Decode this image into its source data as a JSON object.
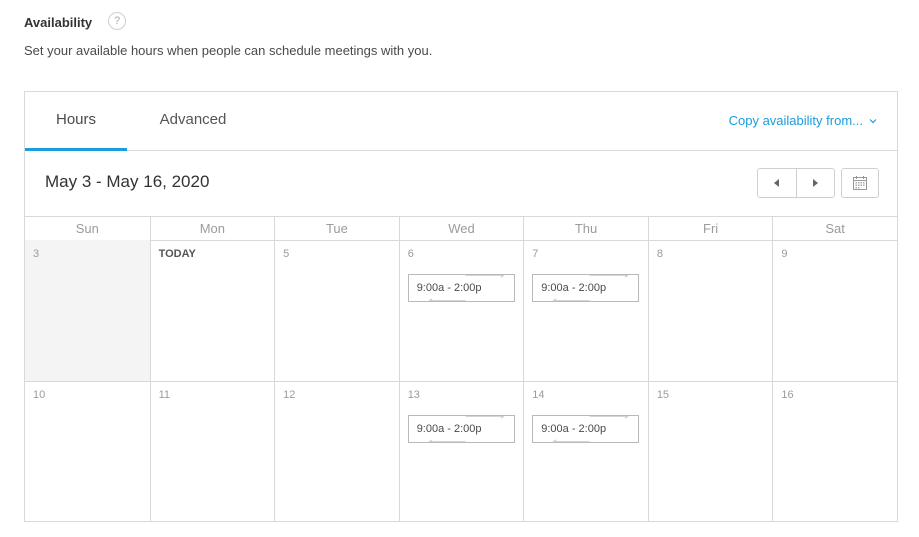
{
  "header": {
    "title": "Availability",
    "help_glyph": "?"
  },
  "subtitle": "Set your available hours when people can schedule meetings with you.",
  "tabs": [
    {
      "label": "Hours",
      "active": true
    },
    {
      "label": "Advanced",
      "active": false
    }
  ],
  "copy_link": "Copy availability from...",
  "range_title": "May 3 - May 16, 2020",
  "weekdays": [
    "Sun",
    "Mon",
    "Tue",
    "Wed",
    "Thu",
    "Fri",
    "Sat"
  ],
  "weeks": [
    [
      {
        "label": "3",
        "past": true,
        "slot": ""
      },
      {
        "label": "TODAY",
        "today": true,
        "slot": ""
      },
      {
        "label": "5",
        "slot": ""
      },
      {
        "label": "6",
        "slot": "9:00a - 2:00p"
      },
      {
        "label": "7",
        "slot": "9:00a - 2:00p"
      },
      {
        "label": "8",
        "slot": ""
      },
      {
        "label": "9",
        "slot": ""
      }
    ],
    [
      {
        "label": "10",
        "slot": ""
      },
      {
        "label": "11",
        "slot": ""
      },
      {
        "label": "12",
        "slot": ""
      },
      {
        "label": "13",
        "slot": "9:00a - 2:00p"
      },
      {
        "label": "14",
        "slot": "9:00a - 2:00p"
      },
      {
        "label": "15",
        "slot": ""
      },
      {
        "label": "16",
        "slot": ""
      }
    ]
  ],
  "colors": {
    "accent": "#1a9ddc",
    "border": "#d9d9d9",
    "past_bg": "#f4f4f4"
  }
}
